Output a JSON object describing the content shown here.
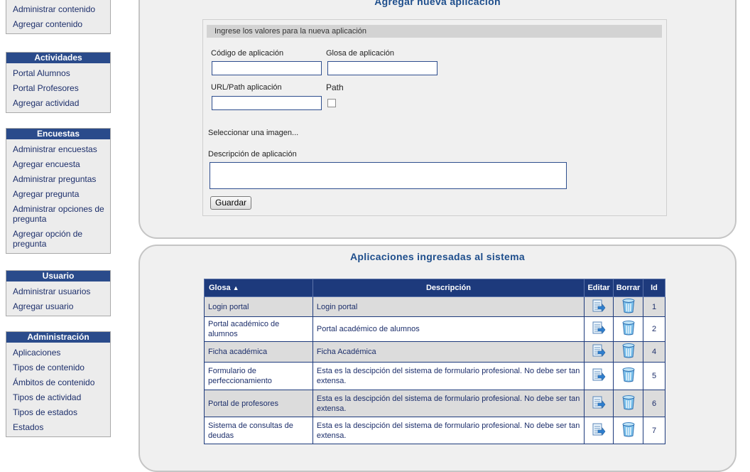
{
  "sidebar": {
    "box0": {
      "items": [
        "Administrar contenido",
        "Agregar contenido"
      ]
    },
    "box1": {
      "title": "Actividades",
      "items": [
        "Portal Alumnos",
        "Portal Profesores",
        "Agregar actividad"
      ]
    },
    "box2": {
      "title": "Encuestas",
      "items": [
        "Administrar encuestas",
        "Agregar encuesta",
        "Administrar preguntas",
        "Agregar pregunta",
        "Administrar opciones de pregunta",
        "Agregar opción de pregunta"
      ]
    },
    "box3": {
      "title": "Usuario",
      "items": [
        "Administrar usuarios",
        "Agregar usuario"
      ]
    },
    "box4": {
      "title": "Administración",
      "items": [
        "Aplicaciones",
        "Tipos de contenido",
        "Ámbitos de contenido",
        "Tipos de actividad",
        "Tipos de estados",
        "Estados"
      ]
    }
  },
  "form": {
    "title": "Agregar nueva aplicación",
    "header": "Ingrese los valores para la nueva aplicación",
    "code_label": "Código de aplicación",
    "code_value": "",
    "glosa_label": "Glosa de aplicación",
    "glosa_value": "",
    "url_label": "URL/Path aplicación",
    "url_value": "",
    "path_label": "Path",
    "path_checked": false,
    "image_link": "Seleccionar una imagen...",
    "desc_label": "Descripción de aplicación",
    "desc_value": "",
    "save_label": "Guardar"
  },
  "list": {
    "title": "Aplicaciones ingresadas al sistema",
    "columns": {
      "glosa": "Glosa",
      "sort_indicator": "▲",
      "descripcion": "Descripción",
      "editar": "Editar",
      "borrar": "Borrar",
      "id": "Id"
    },
    "rows": [
      {
        "glosa": "Login portal",
        "descripcion": "Login portal",
        "id": "1"
      },
      {
        "glosa": "Portal académico de alumnos",
        "descripcion": "Portal académico de alumnos",
        "id": "2"
      },
      {
        "glosa": "Ficha académica",
        "descripcion": "Ficha Académica",
        "id": "4"
      },
      {
        "glosa": "Formulario de perfeccionamiento",
        "descripcion": "Esta es la descipción del sistema de formulario profesional. No debe ser tan extensa.",
        "id": "5"
      },
      {
        "glosa": "Portal de profesores",
        "descripcion": "Esta es la descipción del sistema de formulario profesional. No debe ser tan extensa.",
        "id": "6"
      },
      {
        "glosa": "Sistema de consultas de deudas",
        "descripcion": "Esta es la descipción del sistema de formulario profesional. No debe ser tan extensa.",
        "id": "7"
      }
    ]
  },
  "icons": {
    "edit": "edit-icon",
    "delete": "trash-icon"
  },
  "colors": {
    "header_blue": "#1d3a7c",
    "title_blue": "#1e4e8c",
    "link_blue": "#1d2f6b",
    "row_gray": "#dcdcdc"
  }
}
